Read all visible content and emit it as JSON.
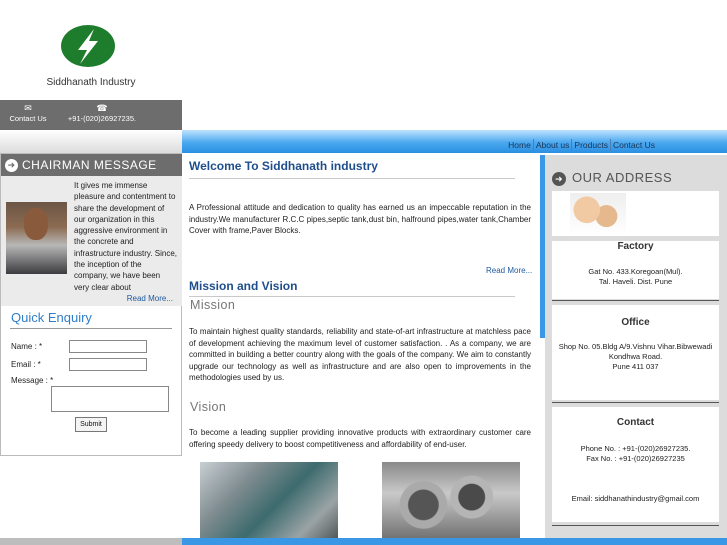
{
  "header": {
    "company_name": "Siddhanath Industry",
    "contact_label": "Contact Us",
    "phone": "+91-(020)26927235."
  },
  "nav": {
    "items": [
      "Home",
      "About us",
      "Products",
      "Contact Us"
    ]
  },
  "chairman": {
    "heading": "CHAIRMAN MESSAGE",
    "message": "It gives me immense pleasure and contentment to share the development of our organization in this aggressive environment in the concrete and infrastructure industry. Since, the inception of the company, we have been very clear about",
    "read_more": "Read More..."
  },
  "enquiry": {
    "heading": "Quick Enquiry",
    "name_label": "Name : *",
    "email_label": "Email : *",
    "message_label": "Message : *",
    "submit_label": "Submit"
  },
  "welcome": {
    "heading": "Welcome To Siddhanath industry",
    "text": "A Professional attitude and dedication to quality has earned us an impeccable reputation in the industry.We manufacturer R.C.C pipes,septic tank,dust bin, halfround pipes,water tank,Chamber Cover with frame,Paver Blocks.",
    "read_more": "Read More..."
  },
  "mission_vision": {
    "heading": "Mission and Vision",
    "mission_heading": "Mission",
    "mission_text": "To maintain highest quality standards, reliability and state-of-art infrastructure at matchless pace of development achieving the maximum level of customer satisfaction. . As a company, we are committed in building a better country along with the goals of the company. We aim to constantly upgrade our technology as well as infrastructure and are also open to improvements in the methodologies used by us.",
    "vision_heading": "Vision",
    "vision_text": "To become a leading supplier providing innovative products with extraordinary customer care offering speedy delivery to boost competitiveness and affordability of end-user."
  },
  "address": {
    "heading": "OUR ADDRESS",
    "factory_title": "Factory",
    "factory_line1": "Gat No. 433.Koregoan(Mul).",
    "factory_line2": "Tal. Haveli. Dist. Pune",
    "office_title": "Office",
    "office_line1": "Shop No. 05.Bldg A/9.Vishnu Vihar.Bibwewadi",
    "office_line2": "Kondhwa Road.",
    "office_line3": "Pune  411 037",
    "contact_title": "Contact",
    "phone_line": "Phone No. : +91-(020)26927235.",
    "fax_line": "Fax No. : +91-(020)26927235",
    "email_line": "Email: siddhanathindustry@gmail.com"
  },
  "colors": {
    "logo_green": "#1e7d2c",
    "nav_blue": "#3a97e6",
    "heading_blue": "#1f4e8c",
    "panel_gray": "#6d6d6d"
  }
}
